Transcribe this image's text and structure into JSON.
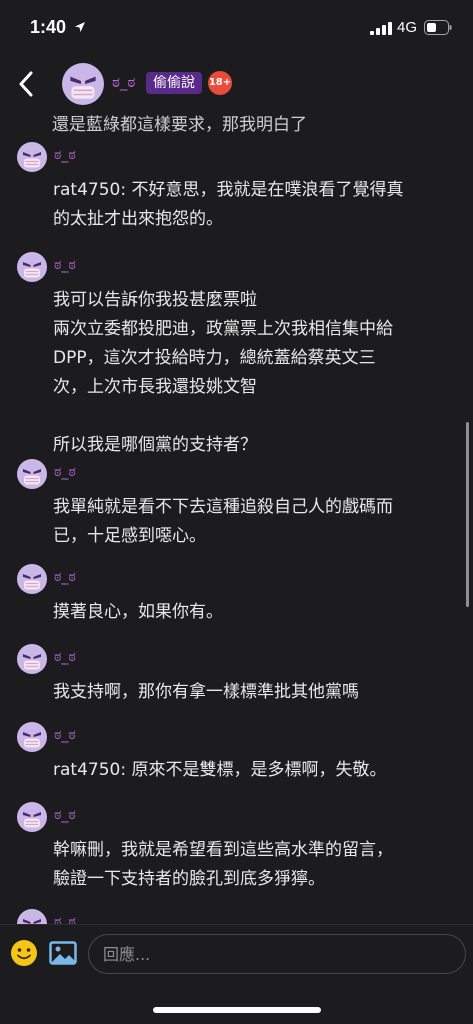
{
  "status": {
    "time": "1:40",
    "network": "4G"
  },
  "header": {
    "author": "ಠ_ಠ",
    "board": "偷偷說",
    "adult_badge": "18+"
  },
  "feed": {
    "partial_text": "還是藍綠都這樣要求，那我明白了",
    "comments": [
      {
        "name": "ಠ_ಠ",
        "lines": [
          "rat4750: 不好意思，我就是在噗浪看了覺得真",
          "的太扯才出來抱怨的。"
        ]
      },
      {
        "name": "ಠ_ಠ",
        "lines": [
          "我可以告訴你我投甚麼票啦",
          "兩次立委都投肥迪，政黨票上次我相信集中給",
          "DPP，這次才投給時力，總統蓋給蔡英文三",
          "次，上次市長我還投姚文智",
          "",
          "所以我是哪個黨的支持者？"
        ]
      },
      {
        "name": "ಠ_ಠ",
        "lines": [
          "我單純就是看不下去這種追殺自己人的戲碼而",
          "已，十足感到噁心。"
        ]
      },
      {
        "name": "ಠ_ಠ",
        "lines": [
          "摸著良心，如果你有。"
        ]
      },
      {
        "name": "ಠ_ಠ",
        "lines": [
          "我支持啊，那你有拿一樣標準批其他黨嗎"
        ]
      },
      {
        "name": "ಠ_ಠ",
        "lines": [
          "rat4750: 原來不是雙標，是多標啊，失敬。"
        ]
      },
      {
        "name": "ಠ_ಠ",
        "lines": [
          "幹嘛刪，我就是希望看到這些高水準的留言，",
          "驗證一下支持者的臉孔到底多猙獰。"
        ]
      },
      {
        "name": "ಠ_ಠ",
        "lines": []
      }
    ]
  },
  "composer": {
    "placeholder": "回應..."
  },
  "icons": {
    "back": "chevron-left-icon",
    "emoji": "emoji-icon",
    "image": "image-icon",
    "avatar": "masked-face-avatar"
  },
  "colors": {
    "username": "#b565d8",
    "board_badge": "#5a2a8a",
    "adult_badge": "#e94b3c",
    "background": "#1c1c1e",
    "emoji": "#f5c518",
    "image_icon": "#7ab8e8"
  }
}
